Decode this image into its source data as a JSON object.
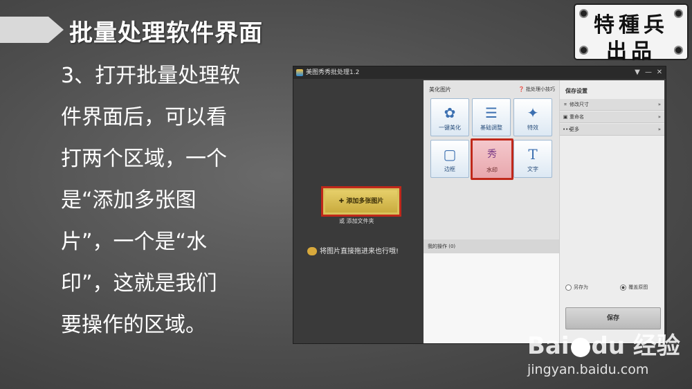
{
  "slide": {
    "title": "批量处理软件界面",
    "body_lines": [
      "3、打开批量处理软",
      "件界面后，可以看",
      "打两个区域，一个",
      "是“添加多张图",
      "片”，一个是“水",
      "印”，这就是我们",
      "要操作的区域。"
    ]
  },
  "stamp": {
    "line1": "特種兵",
    "line2": "出品"
  },
  "app": {
    "window_title": "美图秀秀批处理1.2",
    "controls": {
      "menu": "▼",
      "minimize": "—",
      "close": "✕"
    },
    "left": {
      "add_button": "✚ 添加多张图片",
      "add_folder": "或 添加文件夹",
      "drag_hint": "将图片直接拖进来也行哦!"
    },
    "middle": {
      "heading": "美化图片",
      "tips": "❓ 批处理小技巧",
      "tools": [
        {
          "icon": "flower-icon",
          "glyph": "✿",
          "label": "一键美化"
        },
        {
          "icon": "sliders-icon",
          "glyph": "☰",
          "label": "基础调整"
        },
        {
          "icon": "magic-wand-icon",
          "glyph": "✦",
          "label": "特效"
        },
        {
          "icon": "frame-icon",
          "glyph": "▢",
          "label": "边框"
        },
        {
          "icon": "watermark-icon",
          "glyph": "秀",
          "label": "水印"
        },
        {
          "icon": "text-icon",
          "glyph": "T",
          "label": "文字"
        }
      ],
      "my_ops": "我的操作 (0)"
    },
    "right": {
      "heading": "保存设置",
      "rows": [
        {
          "icon": "crop-icon",
          "glyph": "⌗",
          "label": "修改尺寸",
          "chevron": "»"
        },
        {
          "icon": "rename-icon",
          "glyph": "▣",
          "label": "重命名",
          "chevron": "»"
        },
        {
          "icon": "more-icon",
          "glyph": "•••",
          "label": "更多",
          "chevron": "»"
        }
      ],
      "save_as": "另存为",
      "overwrite": "覆盖原图",
      "save_button": "保存"
    }
  },
  "watermark": {
    "brand_a": "Bai",
    "brand_b": "du",
    "brand_c": "经验",
    "site": "jingyan.baidu.com"
  }
}
